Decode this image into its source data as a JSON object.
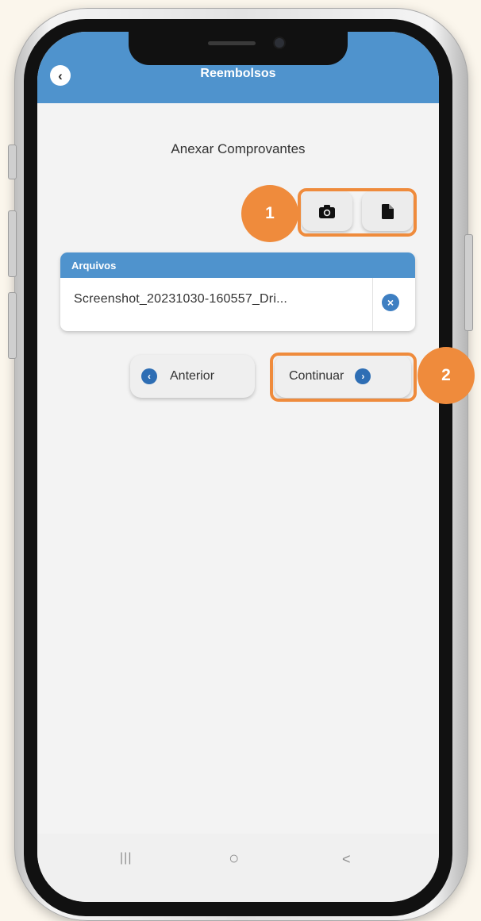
{
  "app": {
    "title": "Reembolsos",
    "back_icon": "chevron-left-icon"
  },
  "page": {
    "subtitle": "Anexar Comprovantes"
  },
  "toolbar": {
    "camera_icon": "camera-icon",
    "document_icon": "document-icon"
  },
  "files": {
    "header": "Arquivos",
    "items": [
      {
        "name": "Screenshot_20231030-160557_Dri...",
        "remove_icon": "close-circle-icon"
      }
    ]
  },
  "navigation": {
    "previous_label": "Anterior",
    "next_label": "Continuar"
  },
  "annotations": {
    "badge_1": "1",
    "badge_2": "2",
    "highlight_color": "#ef8b3c"
  },
  "system_nav": {
    "recents": "|||",
    "home": "○",
    "back": "<"
  },
  "colors": {
    "accent": "#4f93cd",
    "icon_blue": "#2e6eb4",
    "highlight": "#ef8b3c"
  }
}
